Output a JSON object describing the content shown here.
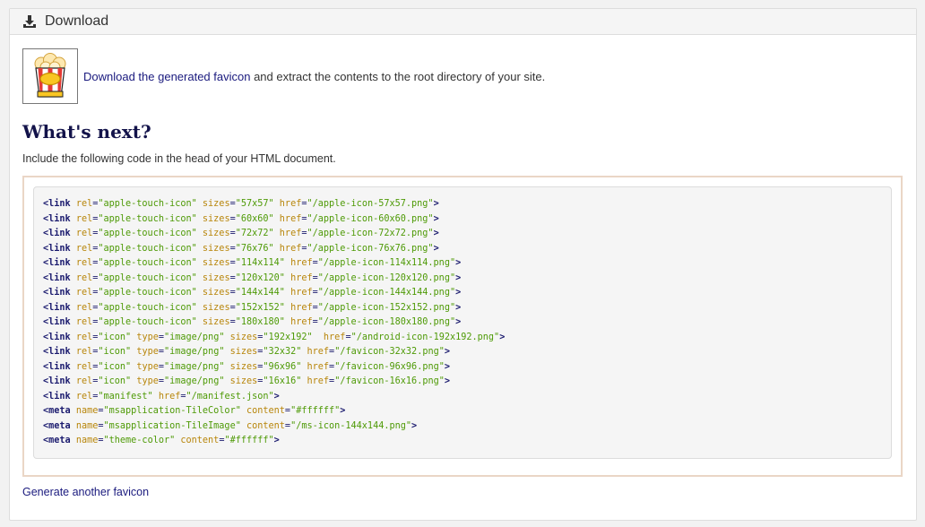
{
  "header": {
    "title": "Download",
    "icon": "download-icon"
  },
  "intro": {
    "image": "popcorn-favicon",
    "link_text": "Download the generated favicon",
    "rest_text": " and extract the contents to the root directory of your site."
  },
  "next": {
    "heading": "What's next?",
    "instruction": "Include the following code in the head of your HTML document."
  },
  "code_lines": [
    {
      "tag": "link",
      "attrs": [
        [
          "rel",
          "apple-touch-icon"
        ],
        [
          "sizes",
          "57x57"
        ],
        [
          "href",
          "/apple-icon-57x57.png"
        ]
      ]
    },
    {
      "tag": "link",
      "attrs": [
        [
          "rel",
          "apple-touch-icon"
        ],
        [
          "sizes",
          "60x60"
        ],
        [
          "href",
          "/apple-icon-60x60.png"
        ]
      ]
    },
    {
      "tag": "link",
      "attrs": [
        [
          "rel",
          "apple-touch-icon"
        ],
        [
          "sizes",
          "72x72"
        ],
        [
          "href",
          "/apple-icon-72x72.png"
        ]
      ]
    },
    {
      "tag": "link",
      "attrs": [
        [
          "rel",
          "apple-touch-icon"
        ],
        [
          "sizes",
          "76x76"
        ],
        [
          "href",
          "/apple-icon-76x76.png"
        ]
      ]
    },
    {
      "tag": "link",
      "attrs": [
        [
          "rel",
          "apple-touch-icon"
        ],
        [
          "sizes",
          "114x114"
        ],
        [
          "href",
          "/apple-icon-114x114.png"
        ]
      ]
    },
    {
      "tag": "link",
      "attrs": [
        [
          "rel",
          "apple-touch-icon"
        ],
        [
          "sizes",
          "120x120"
        ],
        [
          "href",
          "/apple-icon-120x120.png"
        ]
      ]
    },
    {
      "tag": "link",
      "attrs": [
        [
          "rel",
          "apple-touch-icon"
        ],
        [
          "sizes",
          "144x144"
        ],
        [
          "href",
          "/apple-icon-144x144.png"
        ]
      ]
    },
    {
      "tag": "link",
      "attrs": [
        [
          "rel",
          "apple-touch-icon"
        ],
        [
          "sizes",
          "152x152"
        ],
        [
          "href",
          "/apple-icon-152x152.png"
        ]
      ]
    },
    {
      "tag": "link",
      "attrs": [
        [
          "rel",
          "apple-touch-icon"
        ],
        [
          "sizes",
          "180x180"
        ],
        [
          "href",
          "/apple-icon-180x180.png"
        ]
      ]
    },
    {
      "tag": "link",
      "attrs": [
        [
          "rel",
          "icon"
        ],
        [
          "type",
          "image/png"
        ],
        [
          "sizes",
          "192x192"
        ],
        [
          " href",
          "/android-icon-192x192.png"
        ]
      ]
    },
    {
      "tag": "link",
      "attrs": [
        [
          "rel",
          "icon"
        ],
        [
          "type",
          "image/png"
        ],
        [
          "sizes",
          "32x32"
        ],
        [
          "href",
          "/favicon-32x32.png"
        ]
      ]
    },
    {
      "tag": "link",
      "attrs": [
        [
          "rel",
          "icon"
        ],
        [
          "type",
          "image/png"
        ],
        [
          "sizes",
          "96x96"
        ],
        [
          "href",
          "/favicon-96x96.png"
        ]
      ]
    },
    {
      "tag": "link",
      "attrs": [
        [
          "rel",
          "icon"
        ],
        [
          "type",
          "image/png"
        ],
        [
          "sizes",
          "16x16"
        ],
        [
          "href",
          "/favicon-16x16.png"
        ]
      ]
    },
    {
      "tag": "link",
      "attrs": [
        [
          "rel",
          "manifest"
        ],
        [
          "href",
          "/manifest.json"
        ]
      ]
    },
    {
      "tag": "meta",
      "attrs": [
        [
          "name",
          "msapplication-TileColor"
        ],
        [
          "content",
          "#ffffff"
        ]
      ]
    },
    {
      "tag": "meta",
      "attrs": [
        [
          "name",
          "msapplication-TileImage"
        ],
        [
          "content",
          "/ms-icon-144x144.png"
        ]
      ]
    },
    {
      "tag": "meta",
      "attrs": [
        [
          "name",
          "theme-color"
        ],
        [
          "content",
          "#ffffff"
        ]
      ]
    }
  ],
  "footer": {
    "link_text": "Generate another favicon"
  },
  "colors": {
    "link": "#1a1a7e",
    "heading": "#13134a",
    "code_tag": "#1a1a6e",
    "code_attr": "#b8860b",
    "code_value": "#4e9a06",
    "frame_border": "#ead6c6"
  }
}
